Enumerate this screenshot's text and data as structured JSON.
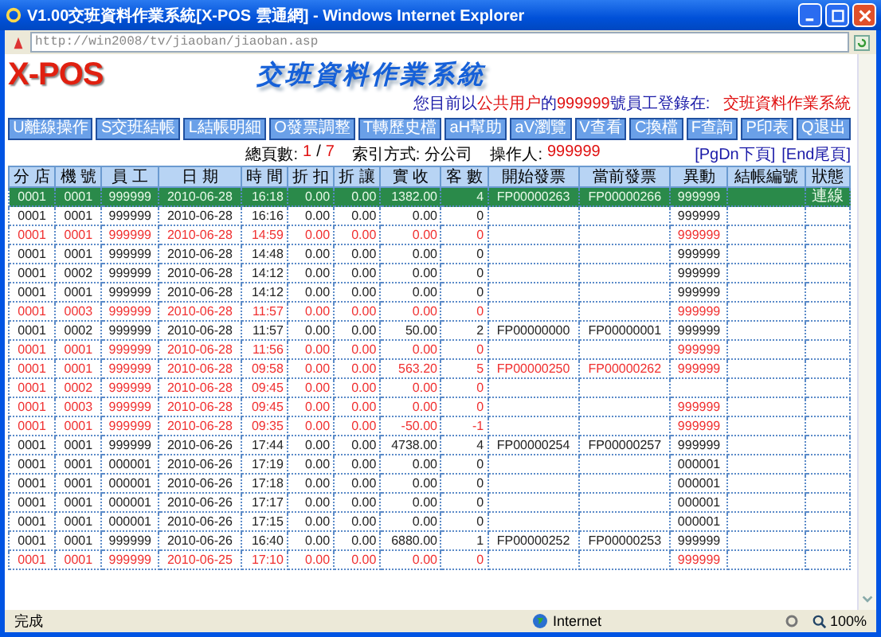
{
  "window": {
    "title": "V1.00交班資料作業系統[X-POS 雲通網] - Windows Internet Explorer"
  },
  "address": "http://win2008/tv/jiaoban/jiaoban.asp",
  "logo": "X-POS",
  "heading": "交班資料作業系統",
  "login": {
    "prefix": "您目前以",
    "user": "公共用户",
    "mid": "的",
    "id": "999999",
    "suffix": "號員工登錄在:",
    "system": "交班資料作業系統"
  },
  "menu": [
    "U離線操作",
    "S交班結帳",
    "L結帳明細",
    "O發票調整",
    "T轉歷史檔",
    "aH幫助",
    "aV瀏覽",
    "V查看",
    "C換檔",
    "F查詢",
    "P印表",
    "Q退出"
  ],
  "info": {
    "pages_label": "總頁數:",
    "page": "1",
    "sep": "/",
    "pages": "7",
    "index_label": "索引方式:",
    "index": "分公司",
    "operator_label": "操作人:",
    "operator": "999999"
  },
  "nav": [
    "[PgDn下頁]",
    "[End尾頁]"
  ],
  "table": {
    "columns": [
      "分 店",
      "機 號",
      "員 工",
      "日 期",
      "時 間",
      "折 扣",
      "折 讓",
      "實 收",
      "客 數",
      "開始發票",
      "當前發票",
      "異動",
      "結帳編號",
      "狀態"
    ],
    "rows": [
      {
        "selected": true,
        "alert": false,
        "store": "0001",
        "machine": "0001",
        "employee": "999999",
        "date": "2010-06-28",
        "time": "16:18",
        "discount": "0.00",
        "allowance": "0.00",
        "received": "1382.00",
        "customers": "4",
        "start_invoice": "FP00000263",
        "current_invoice": "FP00000266",
        "change": "999999",
        "status": "連線"
      },
      {
        "selected": false,
        "alert": false,
        "store": "0001",
        "machine": "0001",
        "employee": "999999",
        "date": "2010-06-28",
        "time": "16:16",
        "discount": "0.00",
        "allowance": "0.00",
        "received": "0.00",
        "customers": "0",
        "change": "999999"
      },
      {
        "selected": false,
        "alert": true,
        "store": "0001",
        "machine": "0001",
        "employee": "999999",
        "date": "2010-06-28",
        "time": "14:59",
        "discount": "0.00",
        "allowance": "0.00",
        "received": "0.00",
        "customers": "0",
        "change": "999999"
      },
      {
        "selected": false,
        "alert": false,
        "store": "0001",
        "machine": "0001",
        "employee": "999999",
        "date": "2010-06-28",
        "time": "14:48",
        "discount": "0.00",
        "allowance": "0.00",
        "received": "0.00",
        "customers": "0",
        "change": "999999"
      },
      {
        "selected": false,
        "alert": false,
        "store": "0001",
        "machine": "0002",
        "employee": "999999",
        "date": "2010-06-28",
        "time": "14:12",
        "discount": "0.00",
        "allowance": "0.00",
        "received": "0.00",
        "customers": "0",
        "change": "999999"
      },
      {
        "selected": false,
        "alert": false,
        "store": "0001",
        "machine": "0001",
        "employee": "999999",
        "date": "2010-06-28",
        "time": "14:12",
        "discount": "0.00",
        "allowance": "0.00",
        "received": "0.00",
        "customers": "0",
        "change": "999999"
      },
      {
        "selected": false,
        "alert": true,
        "store": "0001",
        "machine": "0003",
        "employee": "999999",
        "date": "2010-06-28",
        "time": "11:57",
        "discount": "0.00",
        "allowance": "0.00",
        "received": "0.00",
        "customers": "0",
        "change": "999999"
      },
      {
        "selected": false,
        "alert": false,
        "store": "0001",
        "machine": "0002",
        "employee": "999999",
        "date": "2010-06-28",
        "time": "11:57",
        "discount": "0.00",
        "allowance": "0.00",
        "received": "50.00",
        "customers": "2",
        "start_invoice": "FP00000000",
        "current_invoice": "FP00000001",
        "change": "999999"
      },
      {
        "selected": false,
        "alert": true,
        "store": "0001",
        "machine": "0001",
        "employee": "999999",
        "date": "2010-06-28",
        "time": "11:56",
        "discount": "0.00",
        "allowance": "0.00",
        "received": "0.00",
        "customers": "0",
        "change": "999999"
      },
      {
        "selected": false,
        "alert": true,
        "store": "0001",
        "machine": "0001",
        "employee": "999999",
        "date": "2010-06-28",
        "time": "09:58",
        "discount": "0.00",
        "allowance": "0.00",
        "received": "563.20",
        "customers": "5",
        "start_invoice": "FP00000250",
        "current_invoice": "FP00000262",
        "change": "999999"
      },
      {
        "selected": false,
        "alert": true,
        "store": "0001",
        "machine": "0002",
        "employee": "999999",
        "date": "2010-06-28",
        "time": "09:45",
        "discount": "0.00",
        "allowance": "0.00",
        "received": "0.00",
        "customers": "0"
      },
      {
        "selected": false,
        "alert": true,
        "store": "0001",
        "machine": "0003",
        "employee": "999999",
        "date": "2010-06-28",
        "time": "09:45",
        "discount": "0.00",
        "allowance": "0.00",
        "received": "0.00",
        "customers": "0",
        "change": "999999"
      },
      {
        "selected": false,
        "alert": true,
        "store": "0001",
        "machine": "0001",
        "employee": "999999",
        "date": "2010-06-28",
        "time": "09:35",
        "discount": "0.00",
        "allowance": "0.00",
        "received": "-50.00",
        "customers": "-1",
        "change": "999999"
      },
      {
        "selected": false,
        "alert": false,
        "store": "0001",
        "machine": "0001",
        "employee": "999999",
        "date": "2010-06-26",
        "time": "17:44",
        "discount": "0.00",
        "allowance": "0.00",
        "received": "4738.00",
        "customers": "4",
        "start_invoice": "FP00000254",
        "current_invoice": "FP00000257",
        "change": "999999"
      },
      {
        "selected": false,
        "alert": false,
        "store": "0001",
        "machine": "0001",
        "employee": "000001",
        "date": "2010-06-26",
        "time": "17:19",
        "discount": "0.00",
        "allowance": "0.00",
        "received": "0.00",
        "customers": "0",
        "change": "000001"
      },
      {
        "selected": false,
        "alert": false,
        "store": "0001",
        "machine": "0001",
        "employee": "000001",
        "date": "2010-06-26",
        "time": "17:18",
        "discount": "0.00",
        "allowance": "0.00",
        "received": "0.00",
        "customers": "0",
        "change": "000001"
      },
      {
        "selected": false,
        "alert": false,
        "store": "0001",
        "machine": "0001",
        "employee": "000001",
        "date": "2010-06-26",
        "time": "17:17",
        "discount": "0.00",
        "allowance": "0.00",
        "received": "0.00",
        "customers": "0",
        "change": "000001"
      },
      {
        "selected": false,
        "alert": false,
        "store": "0001",
        "machine": "0001",
        "employee": "000001",
        "date": "2010-06-26",
        "time": "17:15",
        "discount": "0.00",
        "allowance": "0.00",
        "received": "0.00",
        "customers": "0",
        "change": "000001"
      },
      {
        "selected": false,
        "alert": false,
        "store": "0001",
        "machine": "0001",
        "employee": "999999",
        "date": "2010-06-26",
        "time": "16:40",
        "discount": "0.00",
        "allowance": "0.00",
        "received": "6880.00",
        "customers": "1",
        "start_invoice": "FP00000252",
        "current_invoice": "FP00000253",
        "change": "999999"
      },
      {
        "selected": false,
        "alert": true,
        "store": "0001",
        "machine": "0001",
        "employee": "999999",
        "date": "2010-06-25",
        "time": "17:10",
        "discount": "0.00",
        "allowance": "0.00",
        "received": "0.00",
        "customers": "0",
        "change": "999999"
      }
    ]
  },
  "status_bar": {
    "text": "完成",
    "zone": "Internet",
    "zoom": "100%"
  }
}
